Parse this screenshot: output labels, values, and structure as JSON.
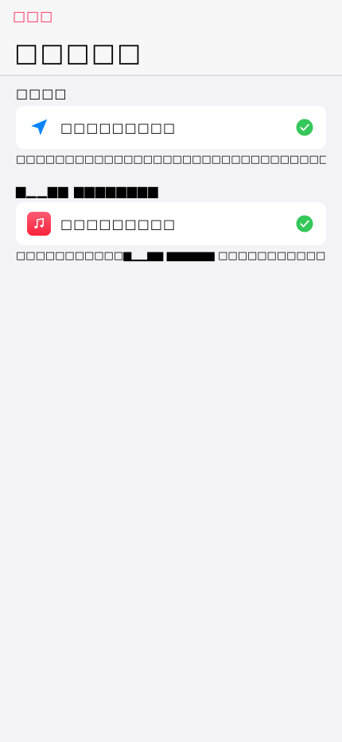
{
  "nav": {
    "back_label": "□□□",
    "title": "□□□□□"
  },
  "sections": [
    {
      "header": "□□□□",
      "row_label": "□□□□□□□□□",
      "row_icon": "location-arrow-icon",
      "footnote": "□□□□□□□□□□□□□□□□□□□□□□□□□□□□□□□□□□□□□□□□□□□□□"
    },
    {
      "header": "▆▁▁▆▆  ▆▆▆▆▆▆▆▆",
      "row_label": "□□□□□□□□□",
      "row_icon": "music-note-icon",
      "footnote": "□□□□□□□□□□□▆▁▁▆▆  ▆▆▆▆▆▆  □□□□□□□□□□□□□□□□□□□□□"
    }
  ],
  "colors": {
    "accent": "#ff2d55",
    "location_blue": "#0a84ff",
    "check_green": "#34c759",
    "background": "#f2f2f7"
  }
}
